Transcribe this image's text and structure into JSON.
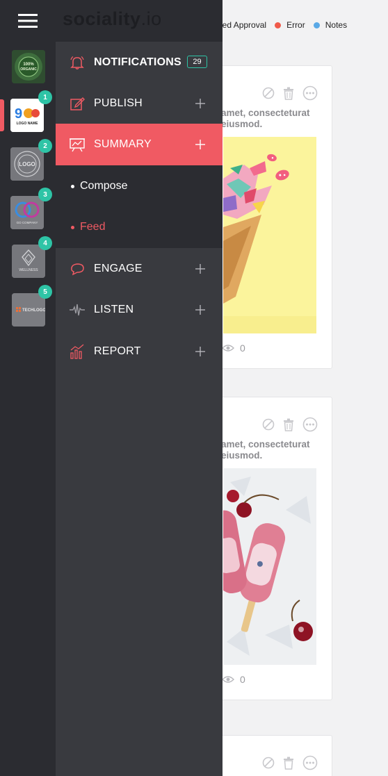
{
  "brand": {
    "name": "sociality",
    "suffix": ".io"
  },
  "legend": [
    {
      "label": "eed Approval",
      "color": "#f0b23a"
    },
    {
      "label": "Error",
      "color": "#f05a4a"
    },
    {
      "label": "Notes",
      "color": "#5aa9e6"
    }
  ],
  "accounts": [
    {
      "name": "100% ORGANIC",
      "badge": ""
    },
    {
      "name": "LOGO NAME",
      "badge": "1"
    },
    {
      "name": "LOGO",
      "badge": "2"
    },
    {
      "name": "GO COMPANY",
      "badge": "3"
    },
    {
      "name": "WELLNESS",
      "badge": "4"
    },
    {
      "name": "TECHLOGO",
      "badge": "5"
    }
  ],
  "menu": {
    "notifications": {
      "label": "NOTIFICATIONS",
      "count": "29"
    },
    "publish": {
      "label": "PUBLISH"
    },
    "summary": {
      "label": "SUMMARY"
    },
    "sub_compose": {
      "label": "Compose"
    },
    "sub_feed": {
      "label": "Feed"
    },
    "engage": {
      "label": "ENGAGE"
    },
    "listen": {
      "label": "LISTEN"
    },
    "report": {
      "label": "REPORT"
    }
  },
  "cards": [
    {
      "caption_line1": "amet, consecteturat",
      "caption_line2": "eiusmod.",
      "views": "0",
      "image": "ice cream cone with confetti"
    },
    {
      "caption_line1": "amet, consecteturat",
      "caption_line2": "eiusmod.",
      "views": "0",
      "image": "berry popsicles on ice"
    }
  ],
  "colors": {
    "accent": "#f05a63",
    "badge": "#2ec4a6",
    "rail": "#2b2c31",
    "menu": "#393a3f"
  }
}
